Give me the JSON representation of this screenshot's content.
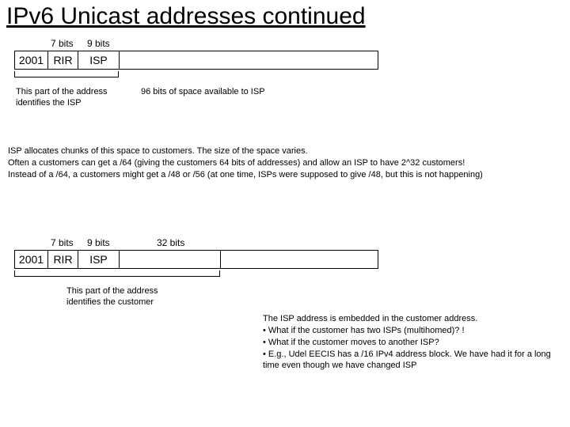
{
  "title": "IPv6 Unicast addresses continued",
  "diagram1": {
    "bits7": "7 bits",
    "bits9": "9 bits",
    "seg_2001": "2001",
    "seg_rir": "RIR",
    "seg_isp": "ISP",
    "caption_left": "This part of the address\nidentifies the ISP",
    "caption_right": "96 bits of space available to ISP"
  },
  "paragraph1": "ISP allocates chunks of this space to customers. The size of the space varies.\nOften a customers can get a /64 (giving the customers 64 bits of addresses) and allow an ISP to have 2^32 customers!\nInstead of a /64, a customers might get a /48 or /56 (at one time, ISPs were supposed to give /48, but this is not happening)",
  "diagram2": {
    "bits7": "7 bits",
    "bits9": "9 bits",
    "bits32": "32 bits",
    "seg_2001": "2001",
    "seg_rir": "RIR",
    "seg_isp": "ISP",
    "caption_left": "This part of the address\nidentifies the customer"
  },
  "paragraph2": "The ISP address is embedded in the customer address.\n• What if the customer has two ISPs (multihomed)? !\n• What if the customer moves to another ISP?\n• E.g., Udel EECIS has a /16 IPv4 address block. We have had it for a long time even though we have changed ISP"
}
